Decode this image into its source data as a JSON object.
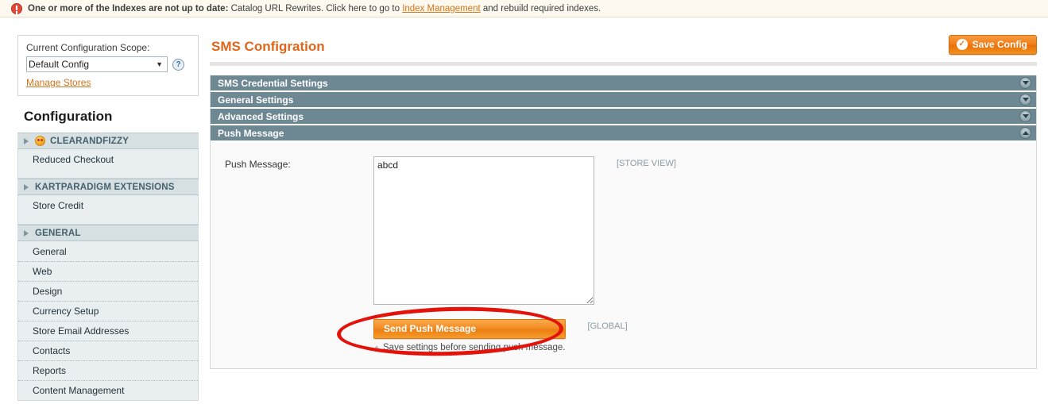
{
  "notice": {
    "icon": "error-circle-icon",
    "strong_text": "One or more of the Indexes are not up to date:",
    "text_before_link": " Catalog URL Rewrites. Click here to go to ",
    "link_text": "Index Management",
    "text_after_link": " and rebuild required indexes."
  },
  "sidebar": {
    "scope_label": "Current Configuration Scope:",
    "scope_value": "Default Config",
    "scope_caret": "▼",
    "help_icon": "question-mark-icon",
    "manage_stores_link": "Manage Stores",
    "heading": "Configuration",
    "groups": [
      {
        "title": "CLEARANDFIZZY",
        "has_icon": true,
        "items": [
          "Reduced Checkout"
        ]
      },
      {
        "title": "KARTPARADIGM EXTENSIONS",
        "has_icon": false,
        "items": [
          "Store Credit"
        ]
      },
      {
        "title": "GENERAL",
        "has_icon": false,
        "items": [
          "General",
          "Web",
          "Design",
          "Currency Setup",
          "Store Email Addresses",
          "Contacts",
          "Reports",
          "Content Management"
        ]
      }
    ]
  },
  "header": {
    "title": "SMS Configration",
    "save_label": "Save Config",
    "save_icon": "check-circle-icon"
  },
  "sections": [
    {
      "label": "SMS Credential Settings",
      "expanded": false,
      "arrow": "chevron-down-icon"
    },
    {
      "label": "General Settings",
      "expanded": false,
      "arrow": "chevron-down-icon"
    },
    {
      "label": "Advanced Settings",
      "expanded": false,
      "arrow": "chevron-down-icon"
    },
    {
      "label": "Push Message",
      "expanded": true,
      "arrow": "chevron-up-icon"
    }
  ],
  "push_form": {
    "field_label": "Push Message:",
    "textarea_value": "abcd",
    "textarea_placeholder": "",
    "field_scope": "[STORE VIEW]",
    "button_label": "Send Push Message",
    "button_scope": "[GLOBAL]",
    "hint_text": "Save settings before sending push message."
  },
  "colors": {
    "accent_orange": "#e2661a",
    "section_header": "#6d8793",
    "notice_bg": "#fdf9ee",
    "annotation_red": "#e3120b"
  }
}
